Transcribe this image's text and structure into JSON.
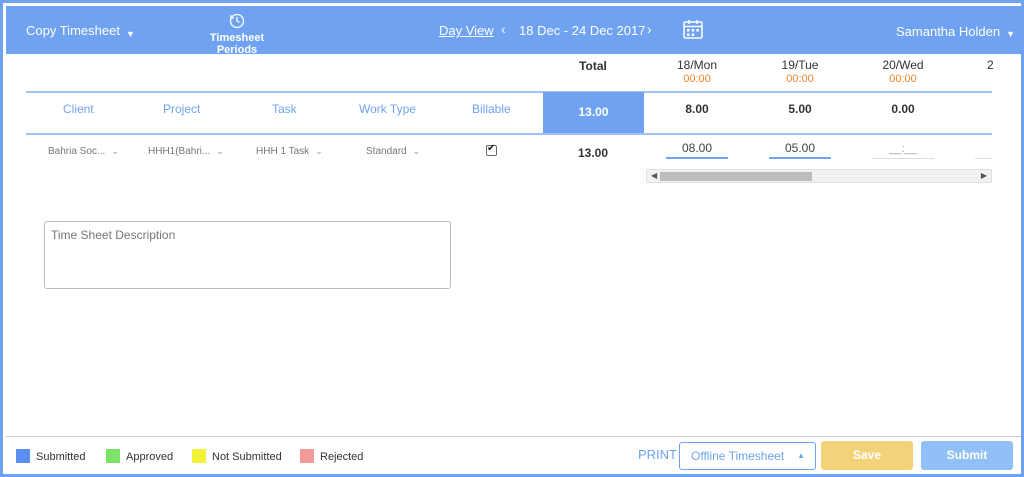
{
  "header": {
    "copy_timesheet": "Copy Timesheet",
    "periods_label": "Timesheet Periods",
    "day_view": "Day View",
    "prev_icon": "chevron-left-icon",
    "date_range": "18 Dec - 24 Dec 2017",
    "next_icon": "chevron-right-icon",
    "calendar_icon": "calendar-icon",
    "user_name": "Samantha Holden",
    "bg_color": "#6fa3f2"
  },
  "grid": {
    "total_label": "Total",
    "days": [
      {
        "label": "18/Mon",
        "hours": "00:00"
      },
      {
        "label": "19/Tue",
        "hours": "00:00"
      },
      {
        "label": "20/Wed",
        "hours": "00:00"
      }
    ],
    "cut_day_label": "2",
    "columns": {
      "client": "Client",
      "project": "Project",
      "task": "Task",
      "work_type": "Work Type",
      "billable": "Billable"
    },
    "grand_total": "13.00",
    "day_totals": [
      "8.00",
      "5.00",
      "0.00"
    ],
    "row": {
      "client": "Bahria Soc...",
      "project": "HHH1(Bahri...",
      "task": "HHH 1 Task",
      "work_type": "Standard",
      "billable": true,
      "total": "13.00",
      "hours": [
        "08.00",
        "05.00",
        "__:__"
      ]
    }
  },
  "description": {
    "placeholder": "Time Sheet Description"
  },
  "legend": [
    {
      "label": "Submitted",
      "color": "#5a8ef0"
    },
    {
      "label": "Approved",
      "color": "#7be36a"
    },
    {
      "label": "Not Submitted",
      "color": "#f2f23a"
    },
    {
      "label": "Rejected",
      "color": "#f29a9a"
    }
  ],
  "footer": {
    "print": "PRINT",
    "offline_select": "Offline Timesheet",
    "save": "Save",
    "submit": "Submit"
  }
}
